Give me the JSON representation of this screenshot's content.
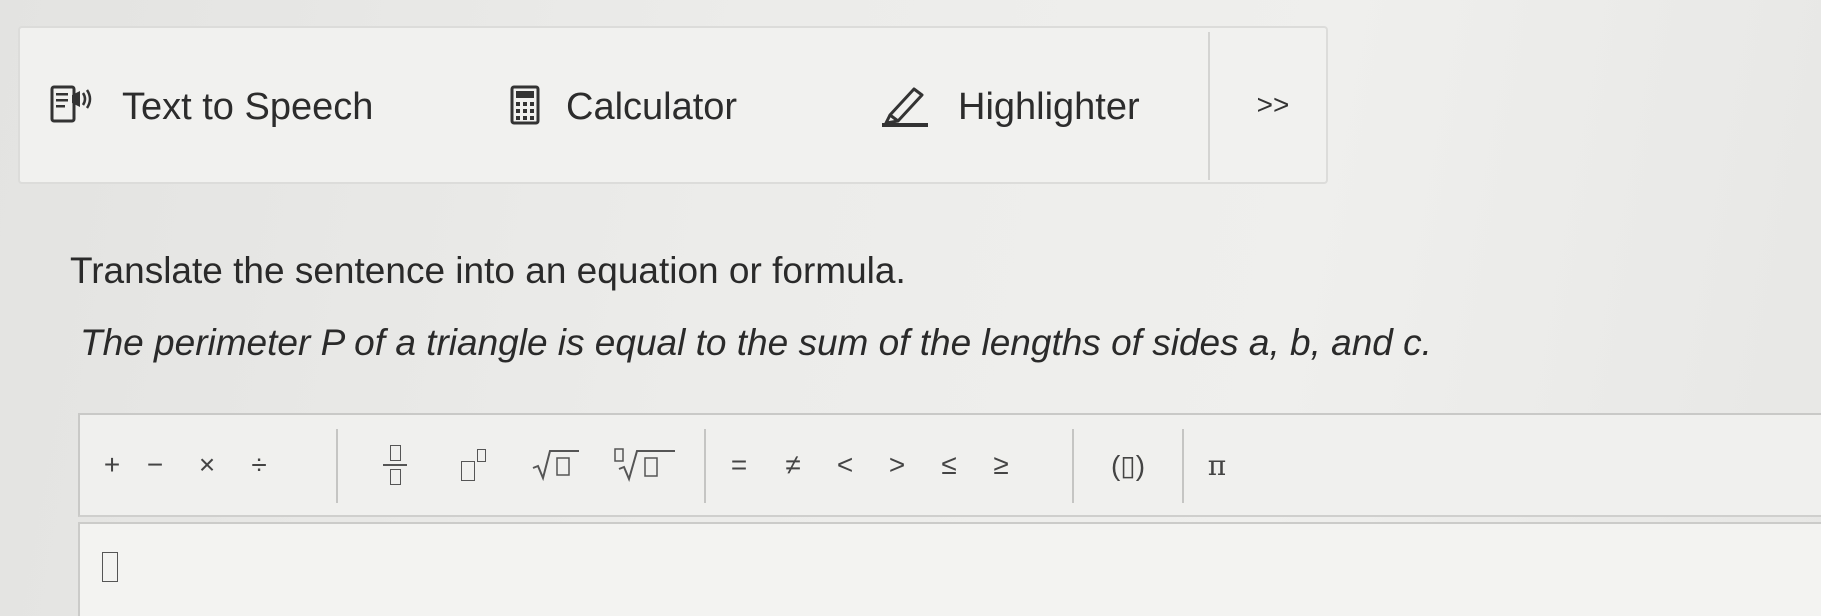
{
  "toolbar": {
    "tools": [
      {
        "label": "Text to Speech",
        "icon": "speaker-icon"
      },
      {
        "label": "Calculator",
        "icon": "calculator-icon"
      },
      {
        "label": "Highlighter",
        "icon": "highlighter-pen-icon"
      }
    ],
    "more_label": ">>"
  },
  "question": {
    "instruction": "Translate the sentence into an equation or formula.",
    "sentence": "The perimeter P of a triangle is equal to the sum of the lengths of sides a, b, and c."
  },
  "palette": {
    "operators": [
      "+",
      "−",
      "×",
      "÷"
    ],
    "templates": [
      "fraction-icon",
      "exponent-icon",
      "square-root-icon",
      "nth-root-icon"
    ],
    "relations": [
      "=",
      "≠",
      "<",
      ">",
      "≤",
      "≥"
    ],
    "grouping": "(▯)",
    "constants": [
      "π"
    ]
  },
  "answer": {
    "value": ""
  }
}
